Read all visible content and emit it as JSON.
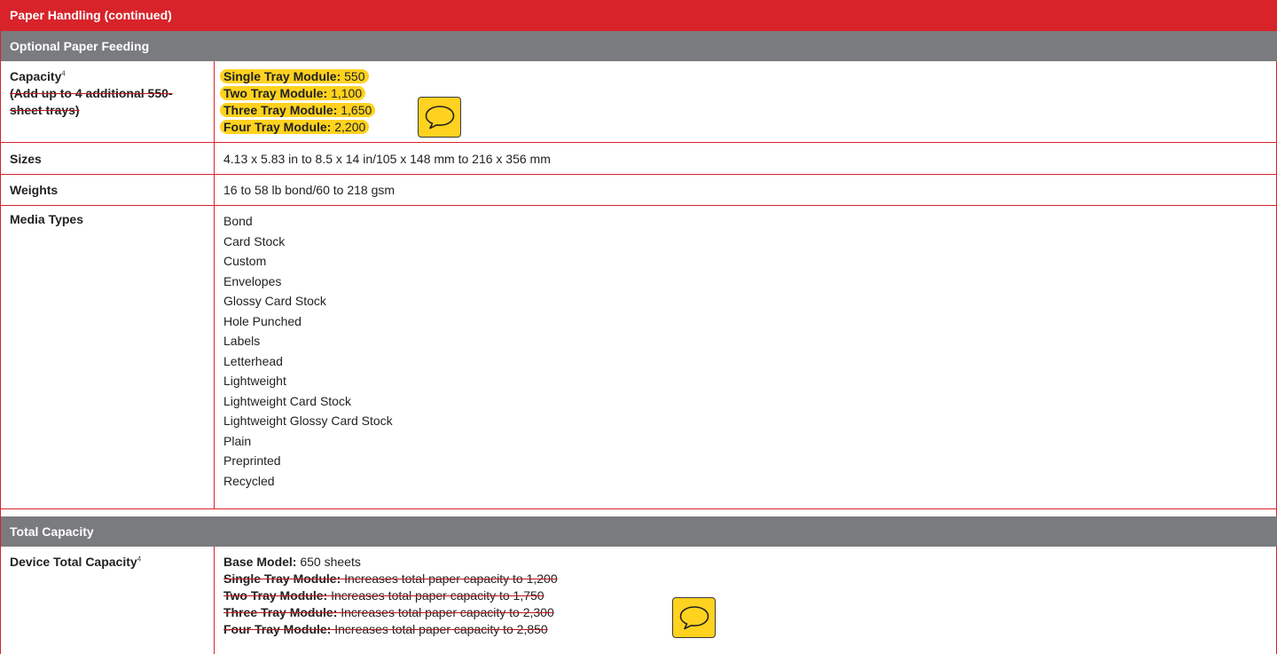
{
  "header": {
    "title": "Paper Handling (continued)"
  },
  "section_optional": {
    "title": "Optional Paper Feeding"
  },
  "capacity": {
    "label": "Capacity",
    "footnote": "4",
    "note": "(Add up to 4 additional 550-sheet trays)",
    "items": [
      {
        "name": "Single Tray Module:",
        "value": " 550"
      },
      {
        "name": "Two Tray Module:",
        "value": " 1,100"
      },
      {
        "name": "Three Tray Module:",
        "value": " 1,650"
      },
      {
        "name": "Four Tray Module:",
        "value": " 2,200"
      }
    ]
  },
  "sizes": {
    "label": "Sizes",
    "value": "4.13 x 5.83 in to 8.5 x 14 in/105 x 148 mm to 216 x 356 mm"
  },
  "weights": {
    "label": "Weights",
    "value": "16 to 58 lb bond/60 to 218 gsm"
  },
  "media": {
    "label": "Media Types",
    "items": [
      "Bond",
      "Card Stock",
      "Custom",
      "Envelopes",
      "Glossy Card Stock",
      "Hole Punched",
      "Labels",
      "Letterhead",
      "Lightweight",
      "Lightweight Card Stock",
      "Lightweight Glossy Card Stock",
      "Plain",
      "Preprinted",
      "Recycled"
    ]
  },
  "section_total": {
    "title": "Total Capacity"
  },
  "device_total": {
    "label": "Device Total Capacity",
    "footnote": "4",
    "base": {
      "name": "Base Model:",
      "value": " 650 sheets"
    },
    "items": [
      {
        "name": "Single Tray Module:",
        "value": " Increases total paper capacity to 1,200"
      },
      {
        "name": "Two Tray Module:",
        "value": " Increases total paper capacity to 1,750"
      },
      {
        "name": "Three Tray Module:",
        "value": " Increases total paper capacity to 2,300"
      },
      {
        "name": "Four Tray Module:",
        "value": " Increases total paper capacity to 2,850"
      }
    ]
  },
  "colors": {
    "accent": "#d8232a",
    "section_gray": "#7a7b7e",
    "highlight": "#ffd21f"
  },
  "icons": [
    "comment-icon",
    "comment-icon"
  ]
}
